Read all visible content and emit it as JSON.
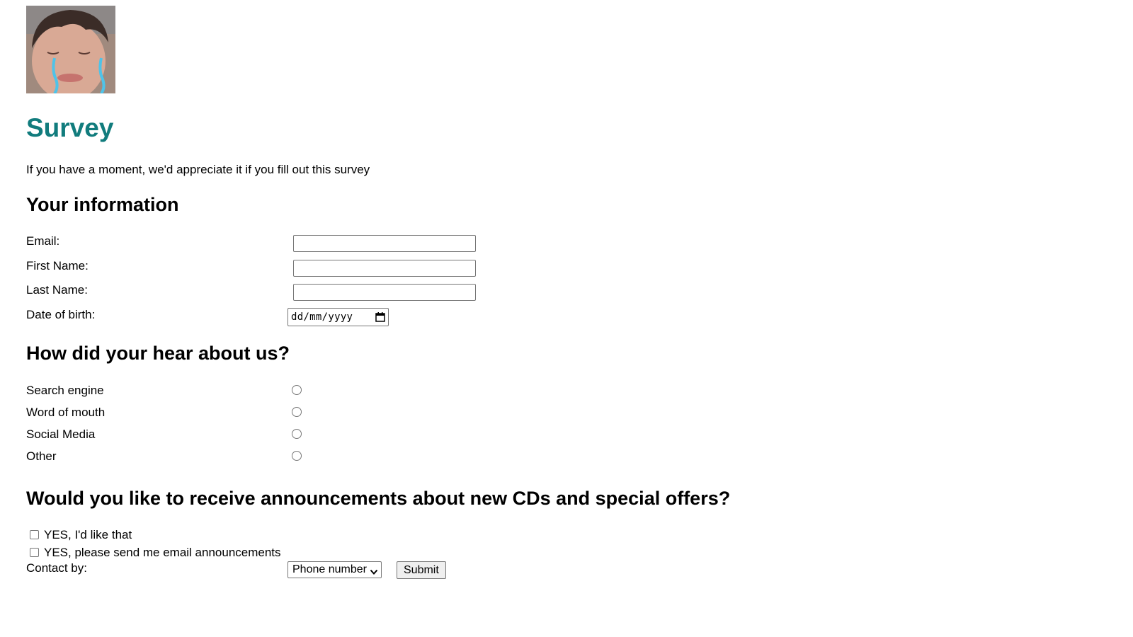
{
  "header": {
    "avatar_alt": "avatar",
    "title": "Survey",
    "intro": "If you have a moment, we'd appreciate it if you fill out this survey"
  },
  "info": {
    "heading": "Your information",
    "email_label": "Email:",
    "email_value": "",
    "first_name_label": "First Name:",
    "first_name_value": "",
    "last_name_label": "Last Name:",
    "last_name_value": "",
    "dob_label": "Date of birth:",
    "dob_placeholder": "dd/mm/yyyy",
    "dob_icon": "calendar-icon"
  },
  "hear": {
    "heading": "How did your hear about us?",
    "options": [
      {
        "label": "Search engine",
        "checked": false
      },
      {
        "label": "Word of mouth",
        "checked": false
      },
      {
        "label": "Social Media",
        "checked": false
      },
      {
        "label": "Other",
        "checked": false
      }
    ]
  },
  "announcements": {
    "heading": "Would you like to receive announcements about new CDs and special offers?",
    "options": [
      {
        "label": "YES, I'd like that",
        "checked": false
      },
      {
        "label": "YES, please send me email announcements",
        "checked": false
      }
    ],
    "contact_label": "Contact by:",
    "contact_selected": "Phone number",
    "submit_label": "Submit"
  },
  "colors": {
    "title": "#117c7d",
    "tear": "#4fc3e8"
  }
}
